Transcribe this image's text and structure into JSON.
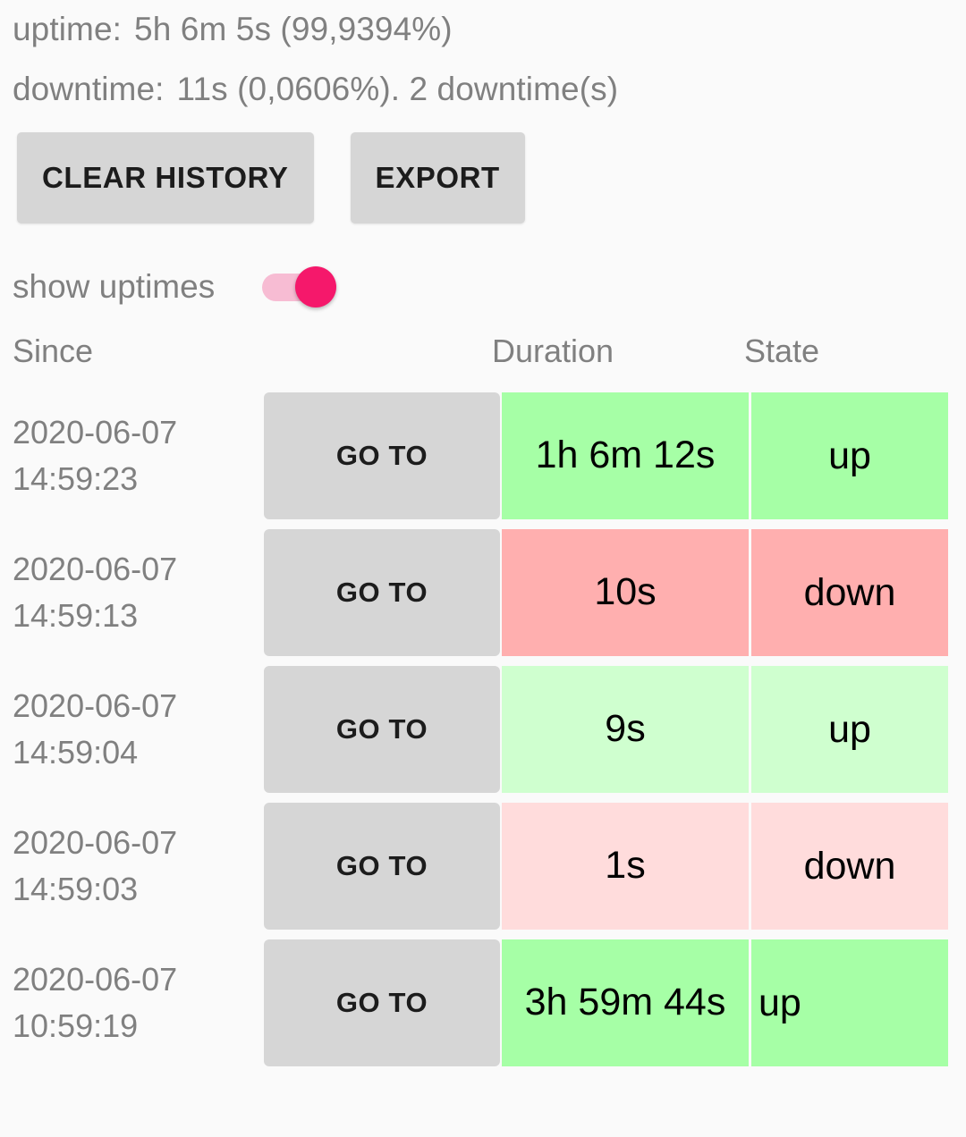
{
  "summary": {
    "uptime_label": "uptime:",
    "uptime_value": "5h 6m 5s (99,9394%)",
    "downtime_label": "downtime:",
    "downtime_value": "11s (0,0606%). 2 downtime(s)"
  },
  "actions": {
    "clear_history_label": "CLEAR HISTORY",
    "export_label": "EXPORT"
  },
  "switch": {
    "label": "show uptimes",
    "state": "on",
    "track_color": "#f7bcd3",
    "thumb_color": "#f5186b"
  },
  "table": {
    "headers": {
      "since": "Since",
      "duration": "Duration",
      "state": "State"
    },
    "goto_label": "GO TO",
    "rows": [
      {
        "date": "2020-06-07",
        "time": "14:59:23",
        "goto": "GO TO",
        "duration": "1h 6m 12s",
        "state": "up",
        "color": "#a6ffa6"
      },
      {
        "date": "2020-06-07",
        "time": "14:59:13",
        "goto": "GO TO",
        "duration": "10s",
        "state": "down",
        "color": "#ffafaf"
      },
      {
        "date": "2020-06-07",
        "time": "14:59:04",
        "goto": "GO TO",
        "duration": "9s",
        "state": "up",
        "color": "#cfffcf"
      },
      {
        "date": "2020-06-07",
        "time": "14:59:03",
        "goto": "GO TO",
        "duration": "1s",
        "state": "down",
        "color": "#ffdcdc"
      },
      {
        "date": "2020-06-07",
        "time": "10:59:19",
        "goto": "GO TO",
        "duration": "3h 59m 44s",
        "state": "up",
        "color": "#a6ffa6"
      }
    ]
  },
  "colors": {
    "background": "#fafafa",
    "text_muted": "#808080",
    "button_fill": "#d6d6d6"
  }
}
